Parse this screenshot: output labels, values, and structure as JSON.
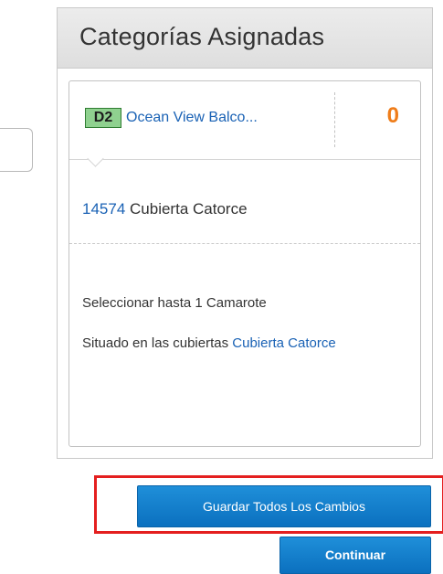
{
  "panel": {
    "title": "Categorías Asignadas"
  },
  "category": {
    "code": "D2",
    "name": "Ocean View Balco...",
    "count": "0"
  },
  "cabin": {
    "number": "14574",
    "deck": "Cubierta Catorce"
  },
  "info": {
    "select_limit": "Seleccionar hasta 1 Camarote",
    "located_prefix": "Situado en las cubiertas",
    "located_deck": "Cubierta Catorce"
  },
  "actions": {
    "save_all": "Guardar Todos Los Cambios",
    "continue": "Continuar"
  },
  "colors": {
    "accent_blue": "#1a62b5",
    "count_orange": "#ef7d1a",
    "badge_green": "#8fd18f",
    "button_blue": "#0b70bf",
    "highlight_red": "#e41f1f"
  }
}
